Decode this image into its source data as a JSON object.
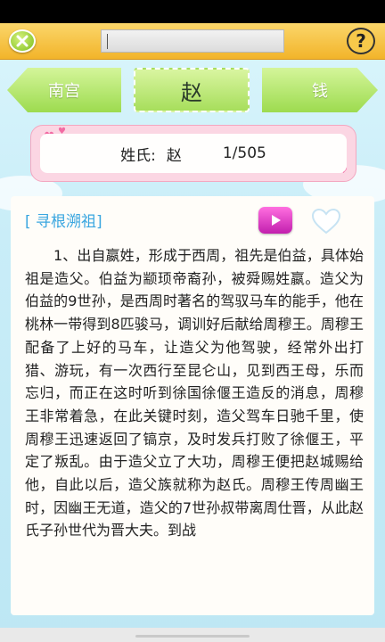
{
  "topbar": {
    "close_icon": "close-x-icon",
    "search_value": "",
    "help_label": "?"
  },
  "nav": {
    "prev_surname": "南宫",
    "current_surname": "赵",
    "next_surname": "钱"
  },
  "info": {
    "label": "姓氏:",
    "surname": "赵",
    "position": "1/505"
  },
  "content": {
    "section_title": "[ 寻根溯祖]",
    "play_icon": "play-icon",
    "favorite_icon": "heart-outline-icon",
    "body": "1、出自嬴姓，形成于西周，祖先是伯益，具体始祖是造父。伯益为颛顼帝裔孙，被舜赐姓嬴。造父为伯益的9世孙，是西周时著名的驾驭马车的能手，他在桃林一带得到8匹骏马，调训好后献给周穆王。周穆王配备了上好的马车，让造父为他驾驶，经常外出打猎、游玩，有一次西行至昆仑山，见到西王母，乐而忘归，而正在这时听到徐国徐偃王造反的消息，周穆王非常着急，在此关键时刻，造父驾车日驰千里，使周穆王迅速返回了镐京，及时发兵打败了徐偃王，平定了叛乱。由于造父立了大功，周穆王便把赵城赐给他，自此以后，造父族就称为赵氏。周穆王传周幽王时，因幽王无道，造父的7世孙叔带离周仕晋，从此赵氏子孙世代为晋大夫。到战"
  },
  "colors": {
    "topbar": "#f2b42a",
    "nav_green": "#9ddb4f",
    "card_pink": "#fbd6e3",
    "title_blue": "#3aa6e0",
    "play_magenta": "#c21fae"
  }
}
